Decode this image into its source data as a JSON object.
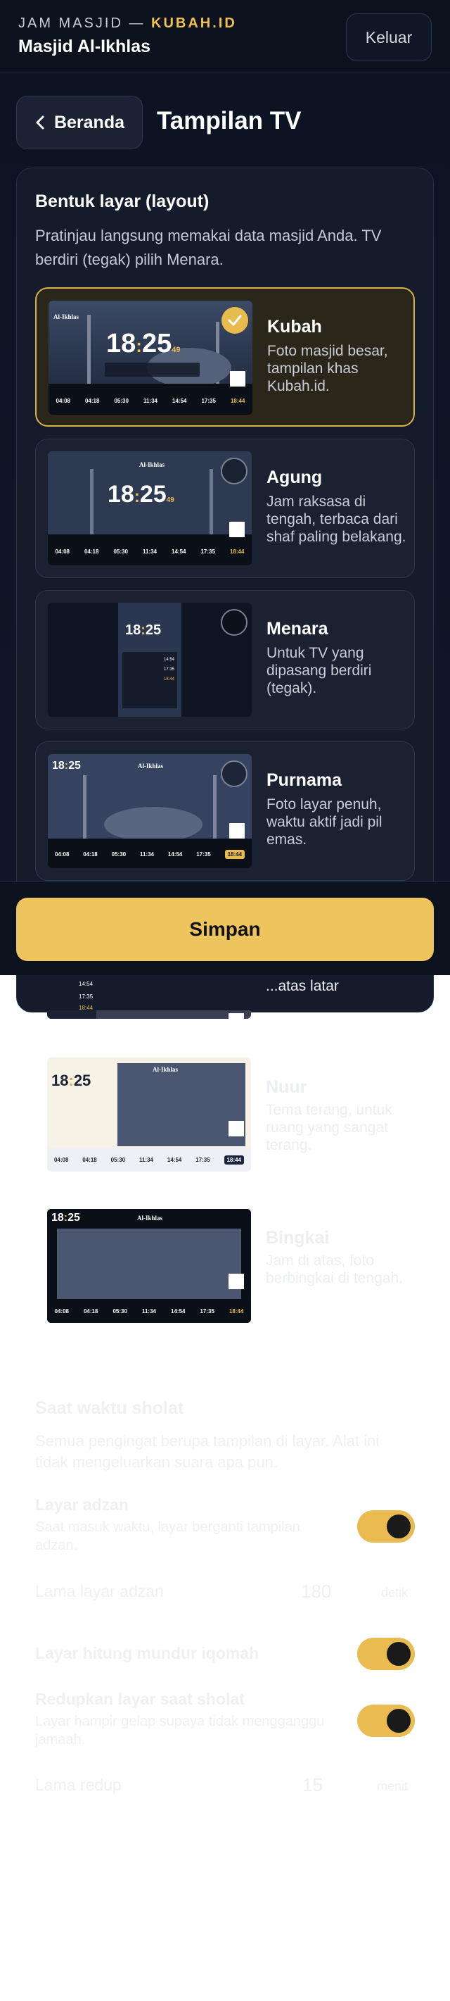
{
  "header": {
    "brand_prefix": "JAM MASJID —",
    "brand_accent": "KUBAH.ID",
    "mosque_name": "Masjid Al-Ikhlas",
    "logout_label": "Keluar"
  },
  "nav": {
    "back_label": "Beranda",
    "page_title": "Tampilan TV"
  },
  "layout_section": {
    "title": "Bentuk layar (layout)",
    "description": "Pratinjau langsung memakai data masjid Anda. TV berdiri (tegak) pilih Menara.",
    "options": [
      {
        "name": "Kubah",
        "description": "Foto masjid besar, tampilan khas Kubah.id.",
        "selected": true
      },
      {
        "name": "Agung",
        "description": "Jam raksasa di tengah, terbaca dari shaf paling belakang.",
        "selected": false
      },
      {
        "name": "Menara",
        "description": "Untuk TV yang dipasang berdiri (tegak).",
        "selected": false
      },
      {
        "name": "Purnama",
        "description": "Foto layar penuh, waktu aktif jadi pil emas.",
        "selected": false
      },
      {
        "name": "",
        "description": "...atas latar",
        "selected": false
      },
      {
        "name": "Nuur",
        "description": "Tema terang, untuk ruang yang sangat terang.",
        "selected": false
      },
      {
        "name": "Bingkai",
        "description": "Jam di atas, foto berbingkai di tengah.",
        "selected": false
      }
    ]
  },
  "preview": {
    "mosque_title": "Al-Ikhlas",
    "clock_hour": "18",
    "clock_minute": "25",
    "clock_seconds": "49",
    "prayer_times": [
      "04:08",
      "04:18",
      "05:30",
      "11:34",
      "14:54",
      "17:35",
      "18:44"
    ],
    "menara_rows": [
      "14:54",
      "17:35",
      "18:44"
    ]
  },
  "save_label": "Simpan",
  "prayer_section": {
    "title": "Saat waktu sholat",
    "description": "Semua pengingat berupa tampilan di layar. Alat ini tidak mengeluarkan suara apa pun.",
    "adzan_screen_label": "Layar adzan",
    "adzan_screen_desc": "Saat masuk waktu, layar berganti tampilan adzan.",
    "adzan_duration_label": "Lama layar adzan",
    "adzan_duration_value": "180",
    "adzan_duration_unit": "detik",
    "iqomah_label": "Layar hitung mundur iqomah",
    "dim_label": "Redupkan layar saat sholat",
    "dim_desc": "Layar hampir gelap supaya tidak mengganggu jamaah.",
    "dim_duration_label": "Lama redup",
    "dim_duration_value": "15",
    "dim_duration_unit": "menit"
  },
  "colors": {
    "accent": "#eec45c",
    "background": "#0c1322",
    "card": "#1a2232"
  }
}
